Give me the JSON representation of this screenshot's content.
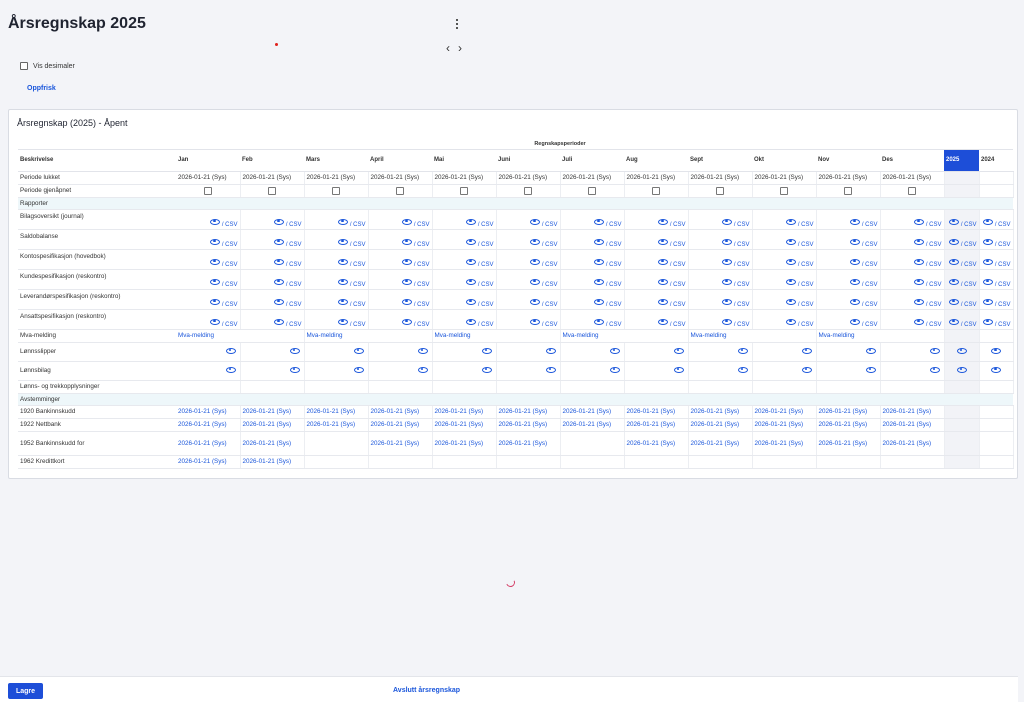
{
  "title": "Årsregnskap 2025",
  "options": {
    "show_decimals_label": "Vis desimaler",
    "refresh_label": "Oppfrisk"
  },
  "nav": {
    "prev": "‹",
    "next": "›"
  },
  "panel": {
    "title": "Årsregnskap (2025) - Åpent"
  },
  "table": {
    "group_header": "Regnskapsperioder",
    "description_header": "Beskrivelse",
    "months": [
      "Jan",
      "Feb",
      "Mars",
      "April",
      "Mai",
      "Juni",
      "Juli",
      "Aug",
      "Sept",
      "Okt",
      "Nov",
      "Des"
    ],
    "years": [
      "2025",
      "2024"
    ],
    "current_year": "2025",
    "closed_label": "Periode lukket",
    "reopened_label": "Periode gjenåpnet",
    "closed_value": "2026-01-21 (Sys)",
    "sections": {
      "reports": "Rapporter",
      "reconciliations": "Avstemminger"
    },
    "csv_label": "/ CSV",
    "reports": [
      "Bilagsoversikt (journal)",
      "Saldobalanse",
      "Kontospesifikasjon (hovedbok)",
      "Kundespesifikasjon (reskontro)",
      "Leverandørspesifikasjon (reskontro)",
      "Ansattspesifikasjon (reskontro)"
    ],
    "vat_label": "Mva-melding",
    "vat_link": "Mva-melding",
    "payslips_label": "Lønnsslipper",
    "payroll_voucher_label": "Lønnsbilag",
    "payroll_info_label": "Lønns- og trekkopplysninger",
    "reconciliations": [
      {
        "label": "1920 Bankinnskudd",
        "value": "2026-01-21 (Sys)"
      },
      {
        "label": "1922 Nettbank",
        "value": "2026-01-21 (Sys)"
      },
      {
        "label": "1952 Bankinnskudd for",
        "value": "2026-01-21 (Sys)"
      },
      {
        "label": "1962 Kredittkort",
        "value": "2026-01-21 (Sys)"
      }
    ]
  },
  "footer": {
    "save_label": "Lagre",
    "close_year_label": "Avslutt årsregnskap"
  },
  "colors": {
    "accent": "#1d4ed8",
    "link": "#1a56db",
    "section_bg": "#eef7fa"
  }
}
